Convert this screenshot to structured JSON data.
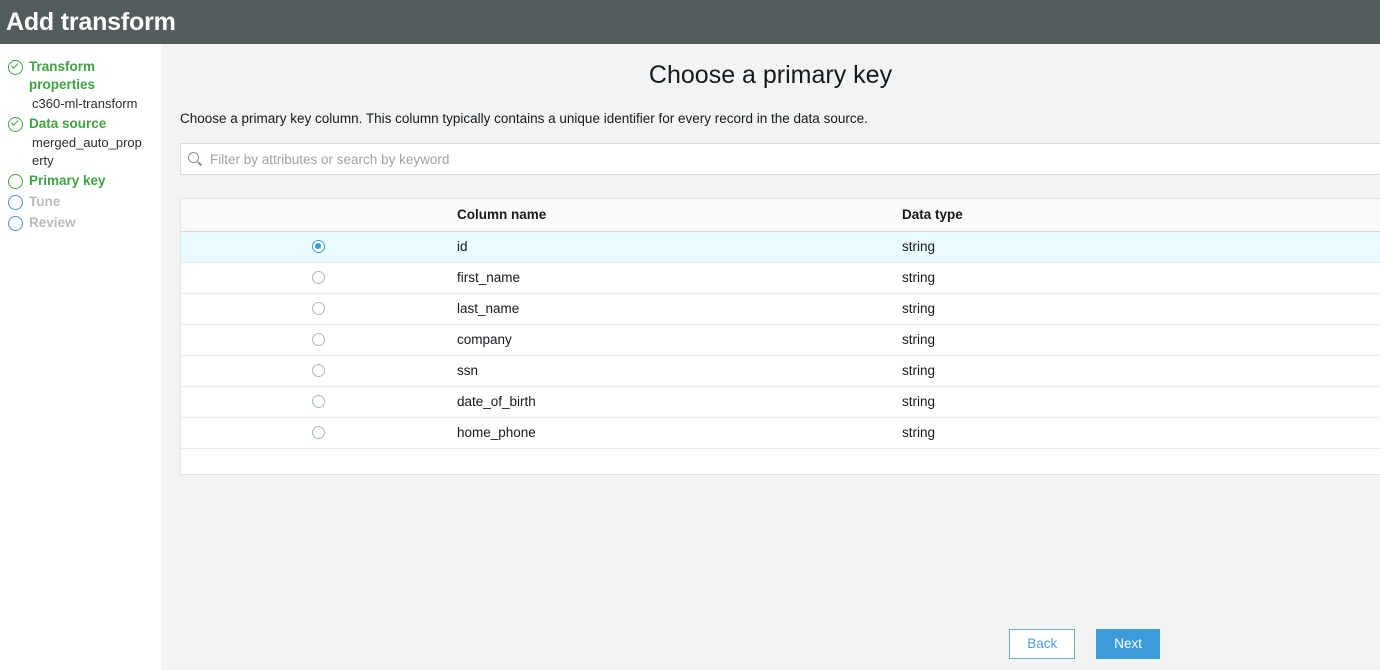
{
  "header": {
    "title": "Add transform"
  },
  "sidebar": {
    "steps": [
      {
        "label": "Transform properties",
        "state": "done",
        "icon": "check-circle-icon",
        "sub": "c360-ml-transform"
      },
      {
        "label": "Data source",
        "state": "done",
        "icon": "check-circle-icon",
        "sub": "merged_auto_property"
      },
      {
        "label": "Primary key",
        "state": "current",
        "icon": "circle-icon",
        "sub": ""
      },
      {
        "label": "Tune",
        "state": "pending",
        "icon": "circle-icon",
        "sub": ""
      },
      {
        "label": "Review",
        "state": "pending",
        "icon": "circle-icon",
        "sub": ""
      }
    ]
  },
  "main": {
    "title": "Choose a primary key",
    "description": "Choose a primary key column. This column typically contains a unique identifier for every record in the data source.",
    "search": {
      "value": "",
      "placeholder": "Filter by attributes or search by keyword",
      "icon": "search-icon"
    },
    "table": {
      "columns": [
        "",
        "Column name",
        "Data type"
      ],
      "rows": [
        {
          "selected": true,
          "name": "id",
          "type": "string"
        },
        {
          "selected": false,
          "name": "first_name",
          "type": "string"
        },
        {
          "selected": false,
          "name": "last_name",
          "type": "string"
        },
        {
          "selected": false,
          "name": "company",
          "type": "string"
        },
        {
          "selected": false,
          "name": "ssn",
          "type": "string"
        },
        {
          "selected": false,
          "name": "date_of_birth",
          "type": "string"
        },
        {
          "selected": false,
          "name": "home_phone",
          "type": "string"
        }
      ]
    },
    "buttons": {
      "back": "Back",
      "next": "Next"
    }
  },
  "colors": {
    "header_bg": "#545b5c",
    "accent_blue": "#3b9cd9",
    "done_green": "#3fa440",
    "pending_gray": "#b9bcbd",
    "selected_row": "#e8fcff",
    "content_bg": "#f2f3f3"
  }
}
